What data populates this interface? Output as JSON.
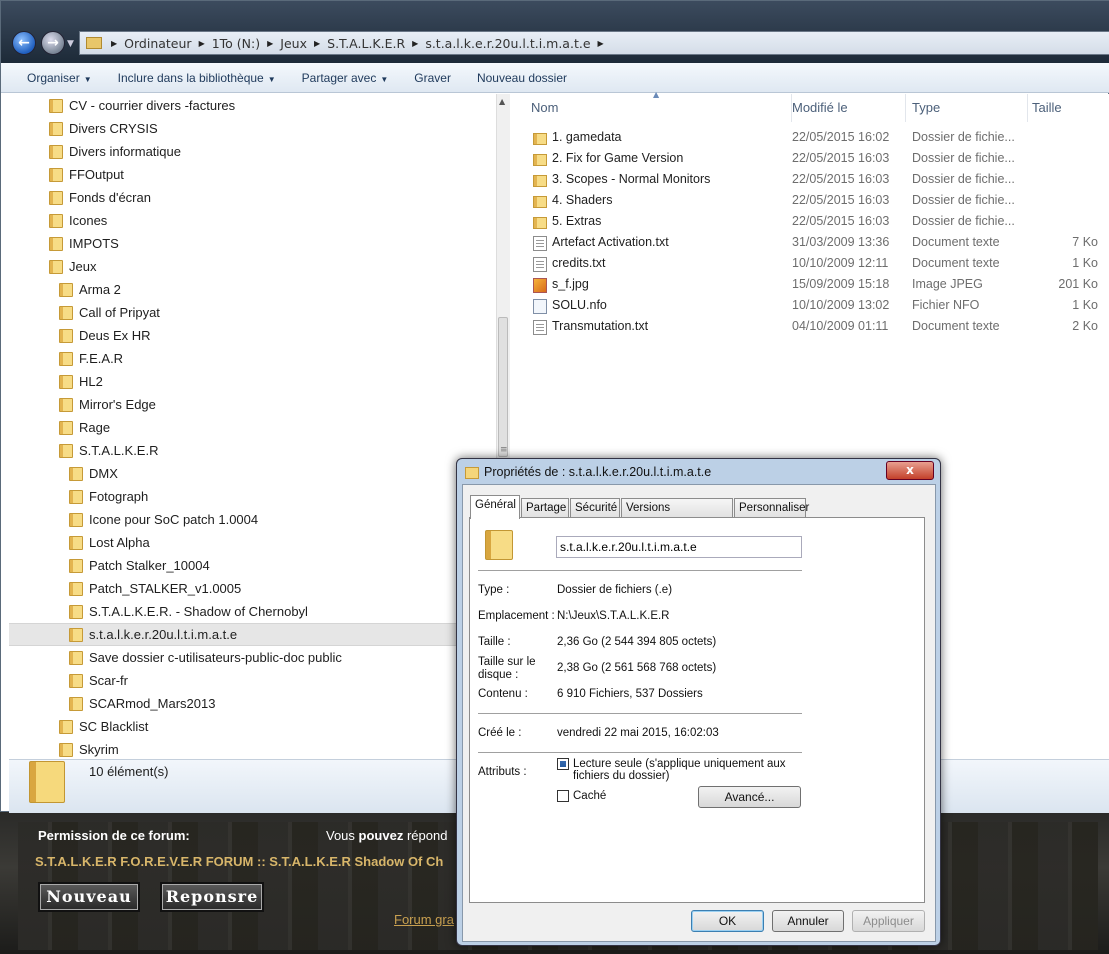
{
  "forum": {
    "permission_label": "Permission de ce forum:",
    "vous_pre": "Vous ",
    "vous_bold": "pouvez",
    "vous_post": " répond",
    "crumb": "S.T.A.L.K.E.R F.O.R.E.V.E.R FORUM :: S.T.A.L.K.E.R Shadow Of Ch",
    "new_button": "Nouveau",
    "reply_button": "Reponsre",
    "link_text": "Forum gra"
  },
  "address": {
    "crumbs": [
      "Ordinateur",
      "1To (N:)",
      "Jeux",
      "S.T.A.L.K.E.R",
      "s.t.a.l.k.e.r.20u.l.t.i.m.a.t.e"
    ]
  },
  "toolbar": {
    "organize": "Organiser",
    "include": "Inclure dans la bibliothèque",
    "share": "Partager avec",
    "burn": "Graver",
    "new_folder": "Nouveau dossier"
  },
  "tree": [
    "CV - courrier divers -factures",
    "Divers CRYSIS",
    "Divers informatique",
    "FFOutput",
    "Fonds d'écran",
    "Icones",
    "IMPOTS",
    "Jeux",
    "Arma 2",
    "Call of Pripyat",
    "Deus Ex HR",
    "F.E.A.R",
    "HL2",
    "Mirror's Edge",
    "Rage",
    "S.T.A.L.K.E.R",
    "DMX",
    "Fotograph",
    "Icone pour SoC patch 1.0004",
    "Lost Alpha",
    "Patch Stalker_10004",
    "Patch_STALKER_v1.0005",
    "S.T.A.L.K.E.R. - Shadow of Chernobyl",
    "s.t.a.l.k.e.r.20u.l.t.i.m.a.t.e",
    "Save dossier c-utilisateurs-public-doc public",
    "Scar-fr",
    "SCARmod_Mars2013",
    "SC Blacklist",
    "Skyrim"
  ],
  "columns": {
    "name": "Nom",
    "modified": "Modifié le",
    "type": "Type",
    "size": "Taille"
  },
  "files": [
    {
      "name": "1. gamedata",
      "date": "22/05/2015 16:02",
      "type": "Dossier de fichie...",
      "size": "",
      "icon": "folder-icon"
    },
    {
      "name": "2. Fix for Game Version",
      "date": "22/05/2015 16:03",
      "type": "Dossier de fichie...",
      "size": "",
      "icon": "folder-icon"
    },
    {
      "name": "3. Scopes - Normal Monitors",
      "date": "22/05/2015 16:03",
      "type": "Dossier de fichie...",
      "size": "",
      "icon": "folder-icon"
    },
    {
      "name": "4. Shaders",
      "date": "22/05/2015 16:03",
      "type": "Dossier de fichie...",
      "size": "",
      "icon": "folder-icon"
    },
    {
      "name": "5. Extras",
      "date": "22/05/2015 16:03",
      "type": "Dossier de fichie...",
      "size": "",
      "icon": "folder-icon"
    },
    {
      "name": "Artefact Activation.txt",
      "date": "31/03/2009 13:36",
      "type": "Document texte",
      "size": "7 Ko",
      "icon": "text-file-icon"
    },
    {
      "name": "credits.txt",
      "date": "10/10/2009 12:11",
      "type": "Document texte",
      "size": "1 Ko",
      "icon": "text-file-icon"
    },
    {
      "name": "s_f.jpg",
      "date": "15/09/2009 15:18",
      "type": "Image JPEG",
      "size": "201 Ko",
      "icon": "image-file-icon"
    },
    {
      "name": "SOLU.nfo",
      "date": "10/10/2009 13:02",
      "type": "Fichier NFO",
      "size": "1 Ko",
      "icon": "nfo-file-icon"
    },
    {
      "name": "Transmutation.txt",
      "date": "04/10/2009 01:11",
      "type": "Document texte",
      "size": "2 Ko",
      "icon": "text-file-icon"
    }
  ],
  "status": {
    "count": "10 élément(s)"
  },
  "dialog": {
    "title": "Propriétés de : s.t.a.l.k.e.r.20u.l.t.i.m.a.t.e",
    "close": "x",
    "tabs": [
      "Général",
      "Partage",
      "Sécurité",
      "Versions précédentes",
      "Personnaliser"
    ],
    "folder_name": "s.t.a.l.k.e.r.20u.l.t.i.m.a.t.e",
    "type_label": "Type :",
    "type_value": "Dossier de fichiers (.e)",
    "location_label": "Emplacement :",
    "location_value": "N:\\Jeux\\S.T.A.L.K.E.R",
    "size_label": "Taille :",
    "size_value": "2,36 Go (2 544 394 805 octets)",
    "disk_label_1": "Taille sur le",
    "disk_label_2": "disque :",
    "disk_value": "2,38 Go (2 561 568 768 octets)",
    "contents_label": "Contenu :",
    "contents_value": "6 910 Fichiers, 537 Dossiers",
    "created_label": "Créé le :",
    "created_value": "vendredi 22 mai 2015, 16:02:03",
    "attributes_label": "Attributs :",
    "readonly_label_1": "Lecture seule (s'applique uniquement aux",
    "readonly_label_2": "fichiers du dossier)",
    "hidden_label": "Caché",
    "advanced": "Avancé...",
    "ok": "OK",
    "cancel": "Annuler",
    "apply": "Appliquer"
  }
}
